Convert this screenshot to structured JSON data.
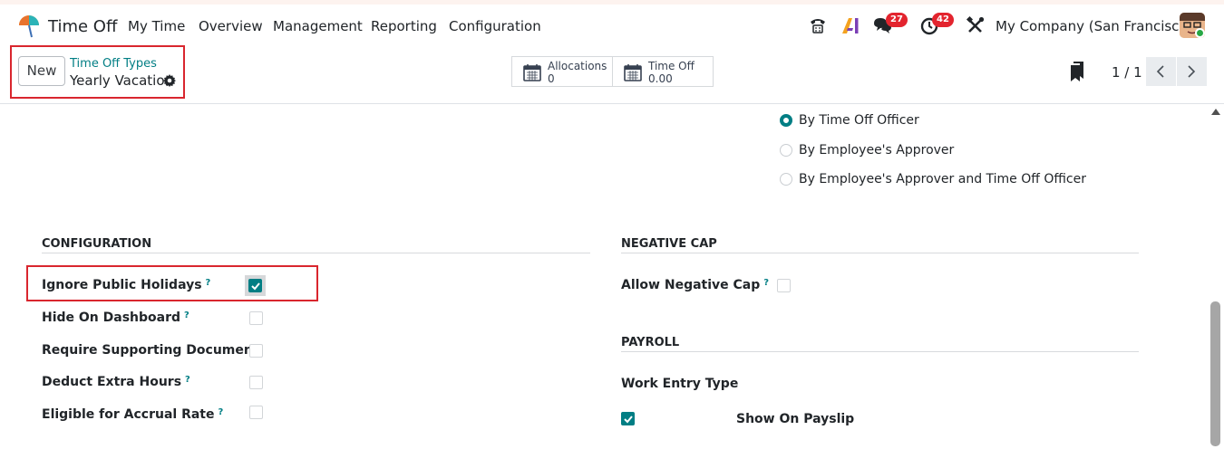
{
  "navbar": {
    "app_name": "Time Off",
    "menus": [
      "My Time",
      "Overview",
      "Management",
      "Reporting",
      "Configuration"
    ],
    "icons": [
      "phone-icon",
      "ai-icon",
      "chat-icon",
      "activity-clock-icon",
      "tools-icon"
    ],
    "chat_badge": "27",
    "activity_badge": "42",
    "company": "My Company (San Francisco)"
  },
  "control_panel": {
    "new_label": "New",
    "breadcrumb": "Time Off Types",
    "record_title": "Yearly Vacation",
    "smart_buttons": [
      {
        "label": "Allocations",
        "value": "0"
      },
      {
        "label": "Time Off",
        "value": "0.00"
      }
    ],
    "pager": "1 / 1"
  },
  "approval": {
    "options": [
      {
        "label": "By Time Off Officer",
        "selected": true
      },
      {
        "label": "By Employee's Approver",
        "selected": false
      },
      {
        "label": "By Employee's Approver and Time Off Officer",
        "selected": false
      }
    ]
  },
  "configuration": {
    "title": "CONFIGURATION",
    "fields": [
      {
        "label": "Ignore Public Holidays",
        "help": "?",
        "checked": true
      },
      {
        "label": "Hide On Dashboard",
        "help": "?",
        "checked": false
      },
      {
        "label": "Require Supporting Document",
        "help": "",
        "checked": false
      },
      {
        "label": "Deduct Extra Hours",
        "help": "?",
        "checked": false
      },
      {
        "label": "Eligible for Accrual Rate",
        "help": "?",
        "checked": false
      }
    ]
  },
  "negative_cap": {
    "title": "NEGATIVE CAP",
    "field_label": "Allow Negative Cap",
    "help": "?",
    "checked": false
  },
  "payroll": {
    "title": "PAYROLL",
    "work_entry_label": "Work Entry Type",
    "show_on_payslip_label": "Show On Payslip",
    "show_on_payslip_checked": true
  },
  "colors": {
    "accent": "#017e84",
    "highlight": "#d9262e",
    "badge": "#e3242e"
  }
}
